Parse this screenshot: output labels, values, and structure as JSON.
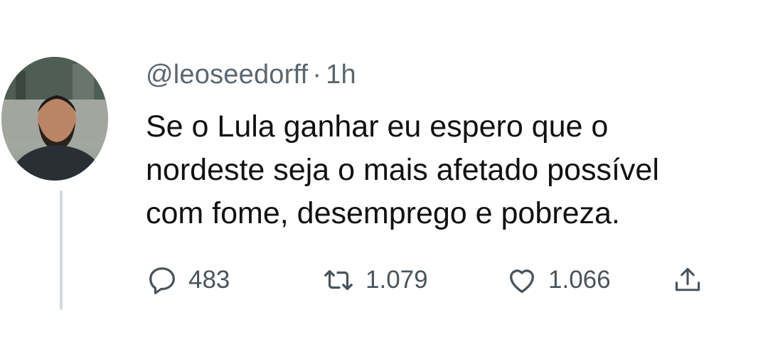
{
  "tweet": {
    "handle": "@leoseedorff",
    "separator": "·",
    "time": "1h",
    "text_lines": [
      "Se o Lula ganhar eu espero que o",
      "nordeste seja o mais afetado possível",
      "com fome, desemprego e pobreza."
    ]
  },
  "actions": {
    "reply": {
      "icon": "reply-icon",
      "count": "483"
    },
    "retweet": {
      "icon": "retweet-icon",
      "count": "1.079"
    },
    "like": {
      "icon": "heart-icon",
      "count": "1.066"
    },
    "share": {
      "icon": "share-icon"
    }
  },
  "colors": {
    "text": "#111111",
    "secondary": "#5b6770",
    "icon": "#4a545c",
    "thread_line": "#cfd9de",
    "background": "#ffffff"
  }
}
